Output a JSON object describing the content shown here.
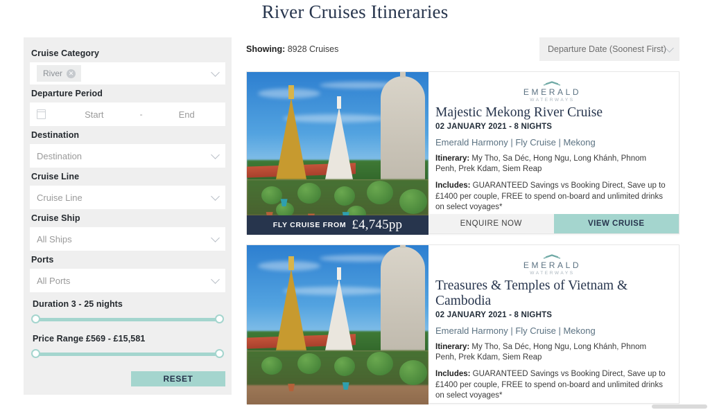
{
  "page": {
    "title": "River Cruises Itineraries"
  },
  "sidebar": {
    "filters": [
      {
        "label": "Cruise Category",
        "type": "chip",
        "chip": "River",
        "remove_icon": "close-icon"
      },
      {
        "label": "Departure Period",
        "type": "daterange",
        "start": "Start",
        "separator": "-",
        "end": "End"
      },
      {
        "label": "Destination",
        "type": "select",
        "value": "Destination"
      },
      {
        "label": "Cruise Line",
        "type": "select",
        "value": "Cruise Line"
      },
      {
        "label": "Cruise Ship",
        "type": "select",
        "value": "All Ships"
      },
      {
        "label": "Ports",
        "type": "select",
        "value": "All Ports"
      }
    ],
    "duration_slider": {
      "label": "Duration 3 - 25 nights",
      "min": 3,
      "max": 25,
      "unit": "nights"
    },
    "price_slider": {
      "label": "Price Range £569 - £15,581",
      "min": "£569",
      "max": "£15,581"
    },
    "reset_label": "RESET"
  },
  "results": {
    "showing_label": "Showing:",
    "showing_count": " 8928 Cruises",
    "sort": {
      "value": "Departure Date (Soonest First)",
      "icon": "chevron-down-icon"
    },
    "cards": [
      {
        "brand": {
          "name": "EMERALD",
          "sub": "WATERWAYS",
          "mark": "waves-icon"
        },
        "title": "Majestic Mekong River Cruise",
        "date": "02 JANUARY 2021 - 8 NIGHTS",
        "meta": "Emerald Harmony | Fly Cruise | Mekong",
        "itinerary_label": "Itinerary:",
        "itinerary": " My Tho, Sa Déc, Hong Ngu, Long Khánh, Phnom Penh, Prek Kdam, Siem Reap",
        "includes_label": "Includes:",
        "includes": " GUARANTEED Savings vs Booking Direct, Save up to £1400 per couple, FREE to spend on-board and unlimited drinks on select voyages*",
        "price_label": "FLY CRUISE FROM",
        "price": "£4,745pp",
        "enquire_label": "ENQUIRE NOW",
        "view_label": "VIEW CRUISE"
      },
      {
        "brand": {
          "name": "EMERALD",
          "sub": "WATERWAYS",
          "mark": "waves-icon"
        },
        "title": "Treasures & Temples of Vietnam & Cambodia",
        "date": "02 JANUARY 2021 - 8 NIGHTS",
        "meta": "Emerald Harmony | Fly Cruise | Mekong",
        "itinerary_label": "Itinerary:",
        "itinerary": " My Tho, Sa Déc, Hong Ngu, Long Khánh, Phnom Penh, Prek Kdam, Siem Reap",
        "includes_label": "Includes:",
        "includes": " GUARANTEED Savings vs Booking Direct, Save up to £1400 per couple, FREE to spend on-board and unlimited drinks on select voyages*"
      }
    ]
  },
  "colors": {
    "navy": "#27354d",
    "teal": "#a4d5ce",
    "sidebar_bg": "#efefef",
    "meta_text": "#5b7282"
  }
}
